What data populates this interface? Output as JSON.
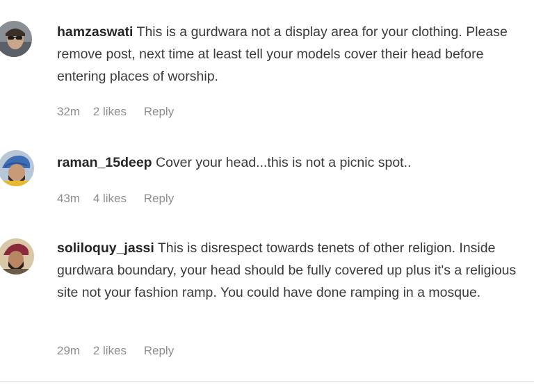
{
  "comments": [
    {
      "username": "hamzaswati",
      "text": "This is a gurdwara not a display area for your clothing. Please remove post, next time at least tell your models cover their head before entering places of worship.",
      "time": "32m",
      "likes": "2 likes",
      "reply": "Reply",
      "avatar_icon": "user-avatar-sunglasses-icon"
    },
    {
      "username": "raman_15deep",
      "text": "Cover your head...this is not a picnic spot..",
      "time": "43m",
      "likes": "4 likes",
      "reply": "Reply",
      "avatar_icon": "user-avatar-turban-icon"
    },
    {
      "username": "soliloquy_jassi",
      "text": "This is disrespect towards tenets of other religion. Inside gurdwara boundary, your head should be fully covered up plus it's a religious site not your fashion ramp. You could have done ramping in a mosque.",
      "time": "29m",
      "likes": "2 likes",
      "reply": "Reply",
      "avatar_icon": "user-avatar-turban-icon"
    }
  ]
}
